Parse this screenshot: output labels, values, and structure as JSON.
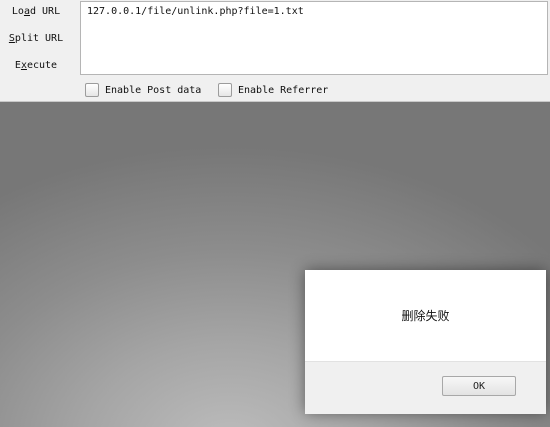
{
  "hackbar": {
    "load_url": {
      "pre": "Lo",
      "key": "a",
      "post": "d URL"
    },
    "split_url": {
      "pre": "",
      "key": "S",
      "post": "plit URL"
    },
    "execute": {
      "pre": "E",
      "key": "x",
      "post": "ecute"
    },
    "url_value": "127.0.0.1/file/unlink.php?file=1.txt",
    "enable_post_label": "Enable Post data",
    "enable_referrer_label": "Enable Referrer"
  },
  "dialog": {
    "message": "删除失败",
    "ok_label": "OK"
  }
}
